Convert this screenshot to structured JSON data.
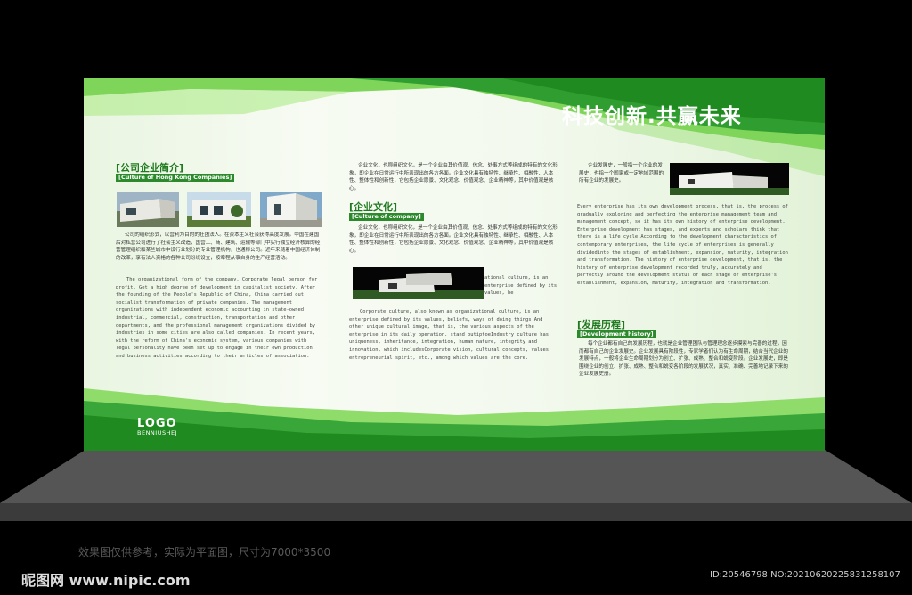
{
  "headline": "科技创新.共赢未来",
  "company": {
    "title": "[公司企业简介]",
    "subtitle": "[Culture of Hong Kong Companies]",
    "cn": "公司的组织形式，以营利为目的的社团法人。在资本主义社会获得高度发展。中国在建国后对私营公司进行了社会主义改造，国营工、商、建筑、运输等部门中实行独立经济核算的经营管理组织和某些城市中设行业划分的专业管理机构，也通称公司。近年来随着中国经济体制的改革，享有法人资格的各种公司纷纷设立，按章程从事自身的生产经营活动。",
    "en": "The organizational form of the company. Corporate legal person for profit. Get a high degree of development in capitalist society. After the founding of the People's Republic of China, China carried out socialist transformation of private companies. The management organizations with independent economic accounting in state-owned industrial, commercial, construction, transportation and other departments, and the professional management organizations divided by industries in some cities are also called companies. In recent years, with the reform of China's economic system, various companies with legal personality have been set up to engage in their own production and business activities according to their articles of association."
  },
  "culture": {
    "title": "[企业文化]",
    "subtitle": "[Culture of company]",
    "cn1": "企业文化，也称组织文化，是一个企业由其价值观、信念、处事方式等组成的特有的文化形象，即企业在日常运行中所表现出的各方各面。企业文化具有独特性、继承性、相融性、人本性、整体性和创新性，它包括企业愿景、文化观念、价值观念、企业精神等，其中价值观是核心。",
    "cn2": "企业文化，也称组织文化，是一个企业由其价值观、信念、处事方式等组成的特有的文化形象，即企业在日常运行中所表现出的各方各面。企业文化具有独特性、继承性、相融性、人本性、整体性和创新性，它包括企业愿景、文化观念、价值观念、企业精神等，其中价值观是核心。",
    "en_side": "ational culture, is an enterprise defined by its values, be",
    "en": "Corporate culture, also known as organizational culture, is an enterprise defined by its values, beliefs, ways of doing things And other unique cultural image, that is, the various aspects of the enterprise in its daily operation. stand outiptoeIndustry culture has uniqueness, inheritance, integration, human nature, integrity and innovation, which includesCorporate vision, cultural concepts, values, entrepreneurial spirit, etc., among which values are the core."
  },
  "history": {
    "intro_cn": "企业发展史，一般指一个企业的发展史；也指一个国家或一定地域范围的所有企业的发展史。",
    "intro_en": "Every enterprise has its own development process, that is, the process of gradually exploring and perfecting the enterprise management team and management concept, so it has its own history of enterprise development. Enterprise development has stages, and experts and scholars think that there is a life cycle.According to the development characteristics of contemporary enterprises, the life cycle of enterprises is generally dividedinto the stages of establishment, expansion, maturity, integration and transformation. The history of enterprise development, that is, the history of enterprise development recorded truly, accurately and perfectly around the development status of each stage of enterprise's establishment, expansion, maturity, integration and transformation.",
    "title": "[发展历程]",
    "subtitle": "[Development history]",
    "cn": "每个企业都有自己的发展历程，也就是企业管理团队与管理理念逐步摸索与完善的过程，因而都有自己的企业发展史。企业发展具有阶段性，专家学者们认为有生命周期，结合当代企业的发展特点，一般将企业生命周期划分为创立、扩张、成熟、整合和蜕变阶段。企业发展史，即是围绕企业的创立、扩张、成熟、整合和蜕变各阶段的发展状况，真实、准确、完善地记录下来的企业发展史册。"
  },
  "logo": {
    "main": "LOGO",
    "sub": "BENNIUSHEJ"
  },
  "caption": "效果图仅供参考，实际为平面图，尺寸为7000*3500",
  "watermark": {
    "site": "昵图网 www.nipic.com",
    "id": "ID:20546798 NO:20210620225831258107"
  },
  "colors": {
    "green_dark": "#1f8a1f",
    "green_light": "#8fd86a",
    "title_green": "#1f7a1f"
  }
}
